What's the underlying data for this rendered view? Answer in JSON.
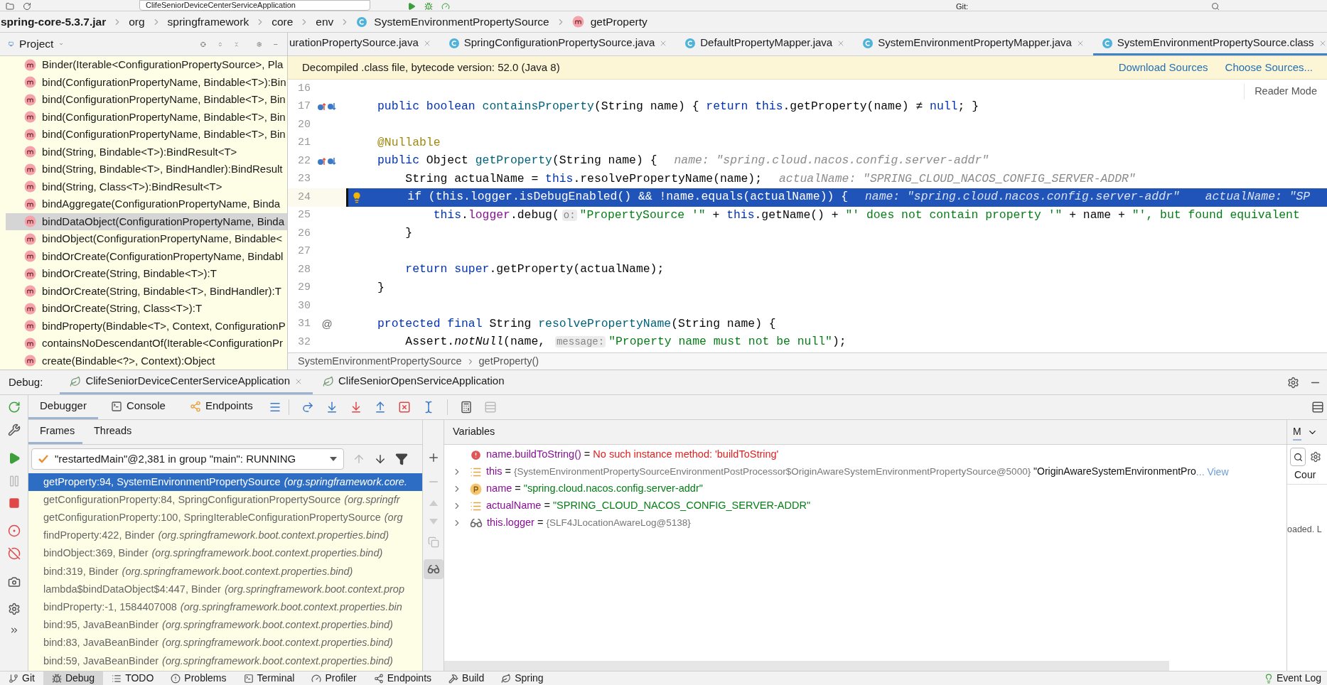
{
  "toolbar": {
    "run_config": "ClifeSeniorDeviceCenterServiceApplication",
    "vcs_label": "Git:"
  },
  "breadcrumb": [
    "spring-core-5.3.7.jar",
    "org",
    "springframework",
    "core",
    "env",
    "SystemEnvironmentPropertySource",
    "getProperty"
  ],
  "project_panel": {
    "title": "Project",
    "items": [
      {
        "label": "Binder(Iterable<ConfigurationPropertySource>, Pla",
        "selected": false
      },
      {
        "label": "bind(ConfigurationPropertyName, Bindable<T>):Bin",
        "selected": false
      },
      {
        "label": "bind(ConfigurationPropertyName, Bindable<T>, Bin",
        "selected": false
      },
      {
        "label": "bind(ConfigurationPropertyName, Bindable<T>, Bin",
        "selected": false
      },
      {
        "label": "bind(ConfigurationPropertyName, Bindable<T>, Bin",
        "selected": false
      },
      {
        "label": "bind(String, Bindable<T>):BindResult<T>",
        "selected": false
      },
      {
        "label": "bind(String, Bindable<T>, BindHandler):BindResult",
        "selected": false
      },
      {
        "label": "bind(String, Class<T>):BindResult<T>",
        "selected": false
      },
      {
        "label": "bindAggregate(ConfigurationPropertyName, Binda",
        "selected": false
      },
      {
        "label": "bindDataObject(ConfigurationPropertyName, Binda",
        "selected": true
      },
      {
        "label": "bindObject(ConfigurationPropertyName, Bindable<",
        "selected": false
      },
      {
        "label": "bindOrCreate(ConfigurationPropertyName, Bindabl",
        "selected": false
      },
      {
        "label": "bindOrCreate(String, Bindable<T>):T",
        "selected": false
      },
      {
        "label": "bindOrCreate(String, Bindable<T>, BindHandler):T",
        "selected": false
      },
      {
        "label": "bindOrCreate(String, Class<T>):T",
        "selected": false
      },
      {
        "label": "bindProperty(Bindable<T>, Context, ConfigurationP",
        "selected": false
      },
      {
        "label": "containsNoDescendantOf(Iterable<ConfigurationPr",
        "selected": false
      },
      {
        "label": "create(Bindable<?>, Context):Object",
        "selected": false
      }
    ]
  },
  "editor": {
    "tabs": [
      {
        "label": "urationPropertySource.java",
        "selected": false
      },
      {
        "label": "SpringConfigurationPropertySource.java",
        "selected": false
      },
      {
        "label": "DefaultPropertyMapper.java",
        "selected": false
      },
      {
        "label": "SystemEnvironmentPropertyMapper.java",
        "selected": false
      },
      {
        "label": "SystemEnvironmentPropertySource.class",
        "selected": true
      }
    ],
    "banner": {
      "message": "Decompiled .class file, bytecode version: 52.0 (Java 8)",
      "links": [
        "Download Sources",
        "Choose Sources..."
      ]
    },
    "reader_mode": "Reader Mode",
    "lines": [
      {
        "number": "16",
        "highlighted": false,
        "kind": "plain"
      },
      {
        "number": "17",
        "highlighted": false,
        "kind": "override",
        "code": [
          {
            "kind": "kw",
            "text": "public boolean "
          },
          {
            "kind": "method",
            "text": "containsProperty"
          },
          {
            "kind": "plain",
            "text": "(String name) { "
          },
          {
            "kind": "kw",
            "text": "return this"
          },
          {
            "kind": "plain",
            "text": ".getProperty(name) ≠ "
          },
          {
            "kind": "kw",
            "text": "null"
          },
          {
            "kind": "plain",
            "text": "; }"
          }
        ]
      },
      {
        "number": "20",
        "highlighted": false,
        "kind": "plain"
      },
      {
        "number": "21",
        "highlighted": false,
        "kind": "plain",
        "code": [
          {
            "kind": "annotation",
            "text": "@Nullable"
          }
        ]
      },
      {
        "number": "22",
        "highlighted": false,
        "kind": "override",
        "code": [
          {
            "kind": "kw",
            "text": "public "
          },
          {
            "kind": "plain",
            "text": "Object "
          },
          {
            "kind": "method",
            "text": "getProperty"
          },
          {
            "kind": "plain",
            "text": "(String name) {"
          }
        ],
        "hints": [
          "name: \"spring.cloud.nacos.config.server-addr\""
        ]
      },
      {
        "number": "23",
        "highlighted": false,
        "kind": "plain",
        "code": [
          {
            "kind": "plain",
            "text": "    String actualName = "
          },
          {
            "kind": "kw",
            "text": "this"
          },
          {
            "kind": "plain",
            "text": ".resolvePropertyName(name);"
          }
        ],
        "hints": [
          "actualName: \"SPRING_CLOUD_NACOS_CONFIG_SERVER-ADDR\""
        ]
      },
      {
        "number": "24",
        "highlighted": true,
        "kind": "plain",
        "code": [
          {
            "kind": "plain",
            "text": "    if (this.logger.isDebugEnabled() && !name.equals(actualName)) {"
          }
        ],
        "hints": [
          "name: \"spring.cloud.nacos.config.server-addr\"",
          "actualName: \"SP"
        ]
      },
      {
        "number": "25",
        "highlighted": false,
        "kind": "plain",
        "code": [
          {
            "kind": "kw",
            "text": "        this"
          },
          {
            "kind": "plain",
            "text": "."
          },
          {
            "kind": "field",
            "text": "logger"
          },
          {
            "kind": "plain",
            "text": ".debug("
          },
          {
            "kind": "param",
            "text": "o:"
          },
          {
            "kind": "str",
            "text": "\"PropertySource '\""
          },
          {
            "kind": "plain",
            "text": " + "
          },
          {
            "kind": "kw",
            "text": "this"
          },
          {
            "kind": "plain",
            "text": ".getName() + "
          },
          {
            "kind": "str",
            "text": "\"' does not contain property '\""
          },
          {
            "kind": "plain",
            "text": " + name + "
          },
          {
            "kind": "str",
            "text": "\"', but found equivalent"
          }
        ]
      },
      {
        "number": "26",
        "highlighted": false,
        "kind": "plain",
        "code": [
          {
            "kind": "plain",
            "text": "    }"
          }
        ]
      },
      {
        "number": "27",
        "highlighted": false,
        "kind": "plain"
      },
      {
        "number": "28",
        "highlighted": false,
        "kind": "plain",
        "code": [
          {
            "kind": "kw",
            "text": "    return super"
          },
          {
            "kind": "plain",
            "text": ".getProperty(actualName);"
          }
        ]
      },
      {
        "number": "29",
        "highlighted": false,
        "kind": "plain",
        "code": [
          {
            "kind": "plain",
            "text": "}"
          }
        ]
      },
      {
        "number": "30",
        "highlighted": false,
        "kind": "plain"
      },
      {
        "number": "31",
        "highlighted": false,
        "kind": "annotated",
        "gutter_text": "@",
        "code": [
          {
            "kind": "kw",
            "text": "protected final "
          },
          {
            "kind": "plain",
            "text": "String "
          },
          {
            "kind": "method",
            "text": "resolvePropertyName"
          },
          {
            "kind": "plain",
            "text": "(String name) {"
          }
        ]
      },
      {
        "number": "32",
        "highlighted": false,
        "kind": "plain",
        "code": [
          {
            "kind": "plain",
            "text": "    Assert."
          },
          {
            "kind": "italic",
            "text": "notNull"
          },
          {
            "kind": "plain",
            "text": "(name, "
          },
          {
            "kind": "param",
            "text": "message:"
          },
          {
            "kind": "str",
            "text": "\"Property name must not be null\""
          },
          {
            "kind": "plain",
            "text": ");"
          }
        ]
      }
    ],
    "path": [
      "SystemEnvironmentPropertySource",
      "getProperty()"
    ]
  },
  "debug": {
    "label": "Debug:",
    "sessions": [
      {
        "label": "ClifeSeniorDeviceCenterServiceApplication",
        "selected": true
      },
      {
        "label": "ClifeSeniorOpenServiceApplication",
        "selected": false
      }
    ],
    "tool_tabs": [
      {
        "label": "Debugger",
        "selected": true
      },
      {
        "label": "Console",
        "selected": false
      },
      {
        "label": "Endpoints",
        "selected": false
      }
    ],
    "frame_tabs": [
      {
        "label": "Frames",
        "selected": true
      },
      {
        "label": "Threads",
        "selected": false
      }
    ],
    "thread": "\"restartedMain\"@2,381 in group \"main\": RUNNING",
    "frames": [
      {
        "method": "getProperty:94, SystemEnvironmentPropertySource",
        "package": "(org.springframework.core.",
        "selected": true
      },
      {
        "method": "getConfigurationProperty:84, SpringConfigurationPropertySource",
        "package": "(org.springfr",
        "selected": false
      },
      {
        "method": "getConfigurationProperty:100, SpringIterableConfigurationPropertySource",
        "package": "(org",
        "selected": false
      },
      {
        "method": "findProperty:422, Binder",
        "package": "(org.springframework.boot.context.properties.bind)",
        "selected": false
      },
      {
        "method": "bindObject:369, Binder",
        "package": "(org.springframework.boot.context.properties.bind)",
        "selected": false
      },
      {
        "method": "bind:319, Binder",
        "package": "(org.springframework.boot.context.properties.bind)",
        "selected": false
      },
      {
        "method": "lambda$bindDataObject$4:447, Binder",
        "package": "(org.springframework.boot.context.prop",
        "selected": false
      },
      {
        "method": "bindProperty:-1, 1584407008",
        "package": "(org.springframework.boot.context.properties.bin",
        "selected": false
      },
      {
        "method": "bind:95, JavaBeanBinder",
        "package": "(org.springframework.boot.context.properties.bind)",
        "selected": false
      },
      {
        "method": "bind:83, JavaBeanBinder",
        "package": "(org.springframework.boot.context.properties.bind)",
        "selected": false
      },
      {
        "method": "bind:59, JavaBeanBinder",
        "package": "(org.springframework.boot.context.properties.bind)",
        "selected": false
      }
    ],
    "variables_title": "Variables",
    "variables": [
      {
        "kind": "error",
        "expandable": false,
        "name": "name.buildToString()",
        "operator": "=",
        "value": {
          "kind": "error",
          "text": "No such instance method: 'buildToString'"
        }
      },
      {
        "kind": "field",
        "expandable": true,
        "name": "this",
        "operator": "=",
        "value": {
          "kind": "object",
          "text": "{SystemEnvironmentPropertySourceEnvironmentPostProcessor$OriginAwareSystemEnvironmentPropertySource@5000}"
        },
        "extra": "\"OriginAwareSystemEnvironmentPro",
        "link": "... View"
      },
      {
        "kind": "param",
        "expandable": true,
        "name": "name",
        "operator": "=",
        "value": {
          "kind": "string",
          "text": "\"spring.cloud.nacos.config.server-addr\""
        }
      },
      {
        "kind": "field",
        "expandable": true,
        "name": "actualName",
        "operator": "=",
        "value": {
          "kind": "string",
          "text": "\"SPRING_CLOUD_NACOS_CONFIG_SERVER-ADDR\""
        }
      },
      {
        "kind": "watch",
        "expandable": true,
        "name": "this.logger",
        "operator": "=",
        "value": {
          "kind": "object",
          "text": "{SLF4JLocationAwareLog@5138}"
        }
      }
    ],
    "side_panel": {
      "tab": "M",
      "column": "Cour",
      "message": "oaded. L"
    }
  },
  "bottom_tools": [
    {
      "label": "Git",
      "selected": false
    },
    {
      "label": "Debug",
      "selected": true
    },
    {
      "label": "TODO",
      "selected": false
    },
    {
      "label": "Problems",
      "selected": false
    },
    {
      "label": "Terminal",
      "selected": false
    },
    {
      "label": "Profiler",
      "selected": false
    },
    {
      "label": "Endpoints",
      "selected": false
    },
    {
      "label": "Build",
      "selected": false
    },
    {
      "label": "Spring",
      "selected": false
    }
  ],
  "event_log": "Event Log"
}
